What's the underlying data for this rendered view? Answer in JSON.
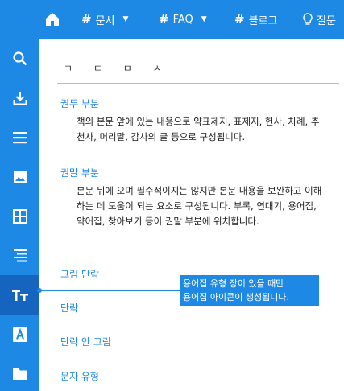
{
  "topbar": {
    "menu": [
      {
        "label": "문서",
        "dropdown": true
      },
      {
        "label": "FAQ",
        "dropdown": true
      },
      {
        "label": "블로그",
        "dropdown": false
      }
    ],
    "question_label": "질문"
  },
  "sidebar": {
    "icons": [
      "search-icon",
      "download-icon",
      "menu-icon",
      "image-icon",
      "grid-icon",
      "align-right-icon",
      "text-type-icon",
      "letter-a-icon",
      "folder-icon"
    ],
    "active_index": 6
  },
  "content": {
    "index_letters": [
      "ㄱ",
      "ㄷ",
      "ㅁ",
      "ㅅ"
    ],
    "entries": [
      {
        "term": "권두 부분",
        "description": "책의 본문 앞에 있는 내용으로 약표제지, 표제지, 헌사, 차례, 추천사, 머리말, 감사의 글 등으로 구성됩니다."
      },
      {
        "term": "권말 부분",
        "description": "본문 뒤에 오며 필수적이지는 않지만 본문 내용을 보완하고 이해하는 데 도움이 되는 요소로 구성됩니다. 부록, 연대기, 용어집, 약어집, 찾아보기 등이 권말 부분에 위치합니다."
      }
    ],
    "links": [
      "그림 단락",
      "단락",
      "단락 안 그림",
      "문자 유형"
    ]
  },
  "tooltip": {
    "line1": "용어집 유형 장이 있을 때만",
    "line2": "용어집 아이콘이 생성됩니다."
  },
  "colors": {
    "primary": "#1e88e5",
    "active": "#1565c0",
    "text": "#222222"
  }
}
